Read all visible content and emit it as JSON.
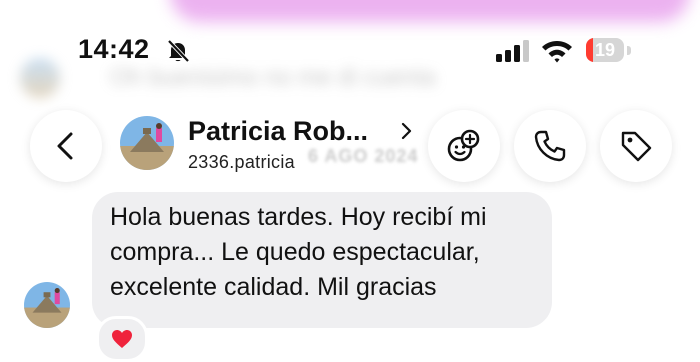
{
  "status_bar": {
    "time": "14:42",
    "battery_percent": "19",
    "battery_level": 0.19,
    "icons": [
      "bell-slash-icon",
      "cellular-signal-icon",
      "wifi-icon",
      "battery-icon"
    ]
  },
  "background": {
    "blurred_message": "Oh buenisimo no me di cuenta",
    "date_separator": "6 AGO 2024"
  },
  "header": {
    "back_icon": "chevron-left-icon",
    "contact_name": "Patricia Rob...",
    "username": "2336.patricia",
    "actions": [
      "effects-icon",
      "phone-icon",
      "tag-icon"
    ]
  },
  "message": {
    "text": "Hola buenas tardes. Hoy recibí mi\ncompra... Le quedo espectacular,\nexcelente calidad. Mil gracias",
    "reaction": "❤️"
  },
  "colors": {
    "bubble": "#efeff1",
    "battery_low": "#ff3b30",
    "pink_background": "#e9a5ee"
  }
}
